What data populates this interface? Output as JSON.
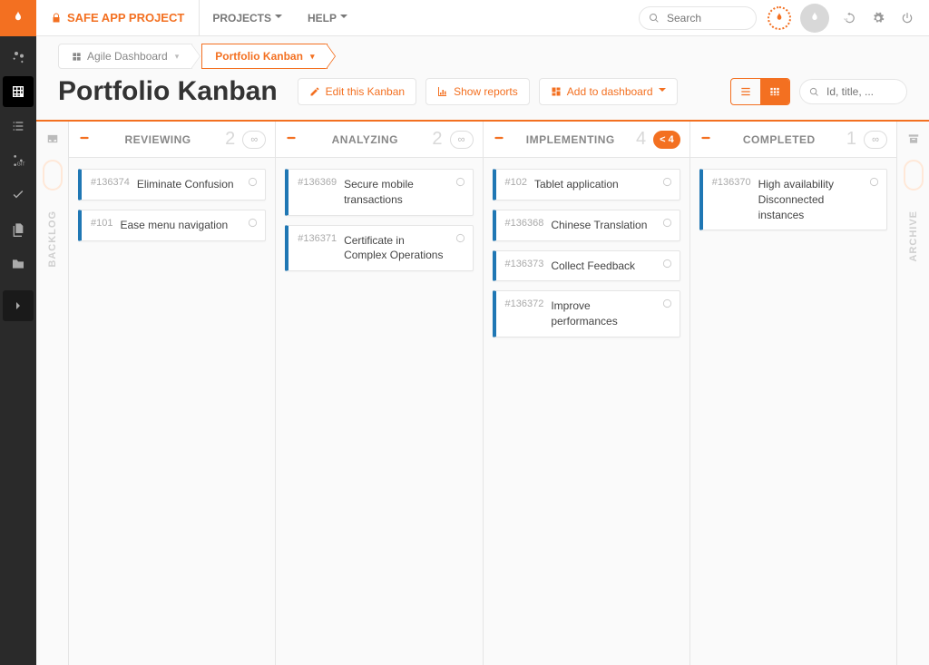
{
  "header": {
    "project_name": "SAFE APP PROJECT",
    "menus": [
      "PROJECTS",
      "HELP"
    ],
    "search_placeholder": "Search"
  },
  "breadcrumb": [
    {
      "label": "Agile Dashboard",
      "active": false
    },
    {
      "label": "Portfolio Kanban",
      "active": true
    }
  ],
  "page": {
    "title": "Portfolio Kanban",
    "buttons": {
      "edit": "Edit this Kanban",
      "reports": "Show reports",
      "dashboard": "Add to dashboard"
    },
    "filter_placeholder": "Id, title, ..."
  },
  "board": {
    "backlog_label": "BACKLOG",
    "archive_label": "ARCHIVE",
    "columns": [
      {
        "name": "REVIEWING",
        "count": 2,
        "wip": "∞",
        "wip_style": "normal",
        "cards": [
          {
            "id": "#136374",
            "title": "Eliminate Confusion"
          },
          {
            "id": "#101",
            "title": "Ease menu navigation"
          }
        ]
      },
      {
        "name": "ANALYZING",
        "count": 2,
        "wip": "∞",
        "wip_style": "normal",
        "cards": [
          {
            "id": "#136369",
            "title": "Secure mobile transactions"
          },
          {
            "id": "#136371",
            "title": "Certificate in Complex Operations"
          }
        ]
      },
      {
        "name": "IMPLEMENTING",
        "count": 4,
        "wip": "< 4",
        "wip_style": "orange",
        "cards": [
          {
            "id": "#102",
            "title": "Tablet application"
          },
          {
            "id": "#136368",
            "title": "Chinese Translation"
          },
          {
            "id": "#136373",
            "title": "Collect Feedback"
          },
          {
            "id": "#136372",
            "title": "Improve performances"
          }
        ]
      },
      {
        "name": "COMPLETED",
        "count": 1,
        "wip": "∞",
        "wip_style": "normal",
        "cards": [
          {
            "id": "#136370",
            "title": "High availability Disconnected instances"
          }
        ]
      }
    ]
  }
}
